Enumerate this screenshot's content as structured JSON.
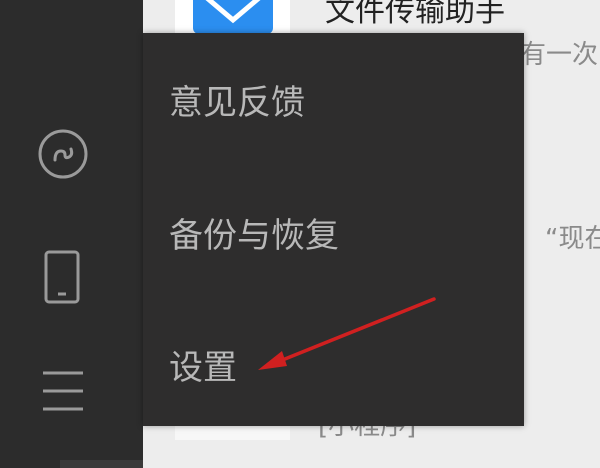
{
  "sidebar": {
    "icons": [
      {
        "name": "mini-program-icon"
      },
      {
        "name": "phone-icon"
      },
      {
        "name": "menu-icon"
      }
    ]
  },
  "chat_list": {
    "title_partial": "文件传输助手",
    "snippet_1": "有一次",
    "snippet_2": "“现在",
    "snippet_3": "[小程序]"
  },
  "menu": {
    "items": [
      {
        "label": "意见反馈"
      },
      {
        "label": "备份与恢复"
      },
      {
        "label": "设置"
      }
    ]
  },
  "annotation": {
    "arrow_color": "#d02020"
  },
  "colors": {
    "sidebar_bg": "#2c2c2c",
    "menu_bg": "#2e2d2d",
    "menu_text": "#b8b8b8",
    "accent_blue": "#2b8ef0"
  }
}
